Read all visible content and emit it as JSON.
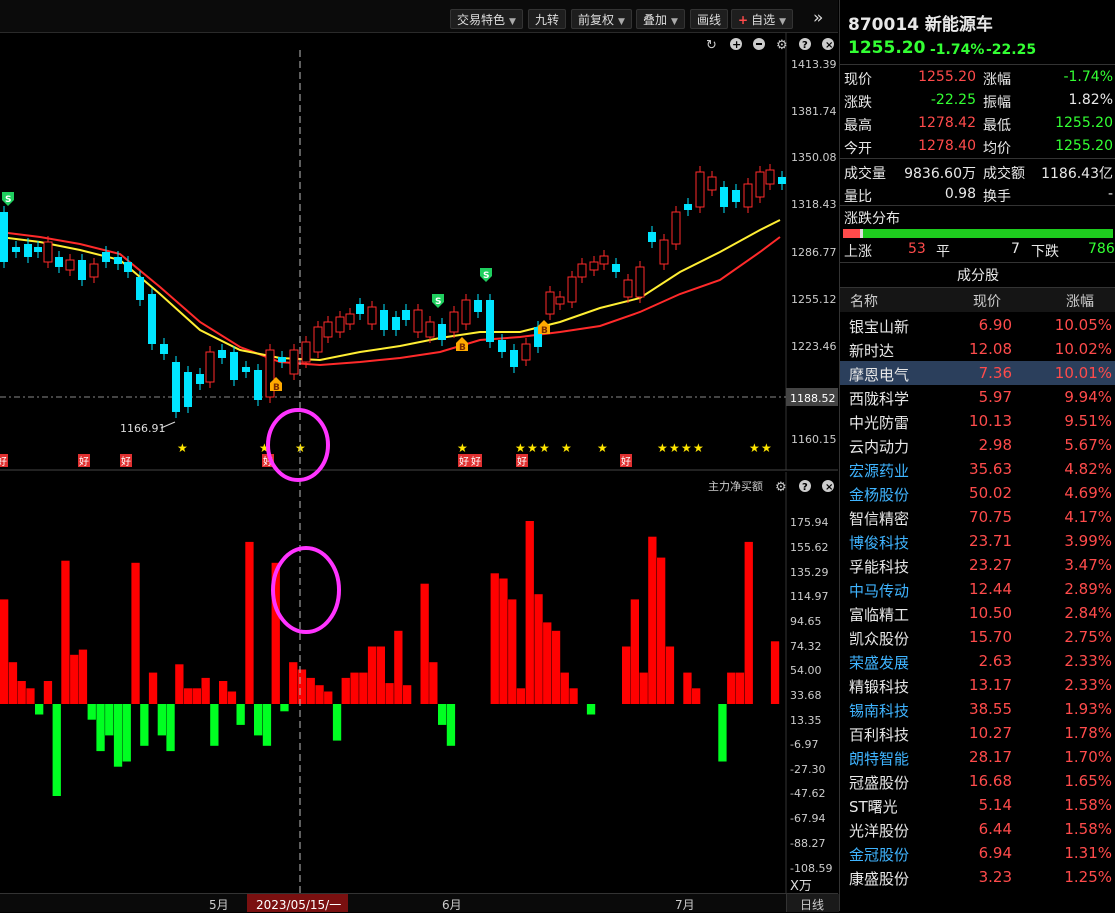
{
  "toolbar": {
    "items": [
      "交易特色",
      "九转",
      "前复权",
      "叠加",
      "画线",
      "自选"
    ],
    "more_icon": "double-chevron-right-icon"
  },
  "main_chart": {
    "y_labels": [
      "1413.39",
      "1381.74",
      "1350.08",
      "1318.43",
      "1286.77",
      "1255.12",
      "1223.46",
      "1160.15"
    ],
    "current_price_tag": "1188.52",
    "low_marker": "1166.91",
    "signal_labels": {
      "hao": "好",
      "b": "B",
      "s": "S"
    },
    "panel_icons": [
      "refresh-icon",
      "zoom-in-icon",
      "zoom-out-icon",
      "settings-icon",
      "help-icon",
      "close-icon"
    ]
  },
  "sub_chart": {
    "title": "主力净买额",
    "y_labels": [
      "175.94",
      "155.62",
      "135.29",
      "114.97",
      "94.65",
      "74.32",
      "54.00",
      "33.68",
      "13.35",
      "-6.97",
      "-27.30",
      "-47.62",
      "-67.94",
      "-88.27",
      "-108.59"
    ],
    "unit": "X万"
  },
  "x_axis": {
    "labels": [
      "5月",
      "6月",
      "7月"
    ],
    "cursor_date": "2023/05/15/一",
    "period": "日线"
  },
  "chart_data": {
    "type": "bar",
    "title": "主力净买额",
    "unit": "万",
    "ylim": [
      -108.59,
      175.94
    ],
    "values": [
      100,
      40,
      22,
      15,
      -10,
      22,
      -88,
      137,
      47,
      52,
      -15,
      -45,
      -30,
      -60,
      -55,
      135,
      -40,
      30,
      -30,
      -45,
      38,
      15,
      15,
      25,
      -40,
      22,
      12,
      -20,
      155,
      -30,
      -40,
      135,
      -7,
      40,
      33,
      25,
      18,
      12,
      -35,
      25,
      30,
      30,
      55,
      55,
      20,
      70,
      18,
      0,
      115,
      40,
      -20,
      -40,
      0,
      0,
      0,
      0,
      125,
      120,
      100,
      15,
      175,
      105,
      78,
      70,
      30,
      15,
      0,
      -10,
      0,
      0,
      0,
      55,
      100,
      30,
      160,
      140,
      55,
      0,
      30,
      15,
      0,
      0,
      -55,
      30,
      30,
      155,
      0,
      0,
      60
    ]
  },
  "stock": {
    "code_name": "870014 新能源车",
    "price": "1255.20",
    "pct": "-1.74%",
    "chg": "-22.25"
  },
  "quotes": [
    {
      "l1": "现价",
      "v1": "1255.20",
      "l2": "涨幅",
      "v2": "-1.74%"
    },
    {
      "l1": "涨跌",
      "v1": "-22.25",
      "l2": "振幅",
      "v2": "1.82%"
    },
    {
      "l1": "最高",
      "v1": "1278.42",
      "l2": "最低",
      "v2": "1255.20"
    },
    {
      "l1": "今开",
      "v1": "1278.40",
      "l2": "均价",
      "v2": "1255.20"
    }
  ],
  "volume": [
    {
      "l1": "成交量",
      "v1": "9836.60万",
      "l2": "成交额",
      "v2": "1186.43亿"
    },
    {
      "l1": "量比",
      "v1": "0.98",
      "l2": "换手",
      "v2": "-"
    }
  ],
  "breadth": {
    "title": "涨跌分布",
    "up_label": "上涨",
    "up": "53",
    "flat_label": "平",
    "flat": "7",
    "down_label": "下跌",
    "down": "786"
  },
  "constituents": {
    "title": "成分股",
    "headers": [
      "名称",
      "现价",
      "涨幅"
    ],
    "rows": [
      {
        "name": "银宝山新",
        "price": "6.90",
        "pct": "10.05%",
        "cyan": false
      },
      {
        "name": "新时达",
        "price": "12.08",
        "pct": "10.02%",
        "cyan": false
      },
      {
        "name": "摩恩电气",
        "price": "7.36",
        "pct": "10.01%",
        "cyan": false
      },
      {
        "name": "西陇科学",
        "price": "5.97",
        "pct": "9.94%",
        "cyan": false
      },
      {
        "name": "中光防雷",
        "price": "10.13",
        "pct": "9.51%",
        "cyan": false
      },
      {
        "name": "云内动力",
        "price": "2.98",
        "pct": "5.67%",
        "cyan": false
      },
      {
        "name": "宏源药业",
        "price": "35.63",
        "pct": "4.82%",
        "cyan": true
      },
      {
        "name": "金杨股份",
        "price": "50.02",
        "pct": "4.69%",
        "cyan": true
      },
      {
        "name": "智信精密",
        "price": "70.75",
        "pct": "4.17%",
        "cyan": false
      },
      {
        "name": "博俊科技",
        "price": "23.71",
        "pct": "3.99%",
        "cyan": true
      },
      {
        "name": "孚能科技",
        "price": "23.27",
        "pct": "3.47%",
        "cyan": false
      },
      {
        "name": "中马传动",
        "price": "12.44",
        "pct": "2.89%",
        "cyan": true
      },
      {
        "name": "富临精工",
        "price": "10.50",
        "pct": "2.84%",
        "cyan": false
      },
      {
        "name": "凯众股份",
        "price": "15.70",
        "pct": "2.75%",
        "cyan": false
      },
      {
        "name": "荣盛发展",
        "price": "2.63",
        "pct": "2.33%",
        "cyan": true
      },
      {
        "name": "精锻科技",
        "price": "13.17",
        "pct": "2.33%",
        "cyan": false
      },
      {
        "name": "锡南科技",
        "price": "38.55",
        "pct": "1.93%",
        "cyan": true
      },
      {
        "name": "百利科技",
        "price": "10.27",
        "pct": "1.78%",
        "cyan": false
      },
      {
        "name": "朗特智能",
        "price": "28.17",
        "pct": "1.70%",
        "cyan": true
      },
      {
        "name": "冠盛股份",
        "price": "16.68",
        "pct": "1.65%",
        "cyan": false
      },
      {
        "name": "ST曙光",
        "price": "5.14",
        "pct": "1.58%",
        "cyan": false
      },
      {
        "name": "光洋股份",
        "price": "6.44",
        "pct": "1.58%",
        "cyan": false
      },
      {
        "name": "金冠股份",
        "price": "6.94",
        "pct": "1.31%",
        "cyan": true
      },
      {
        "name": "康盛股份",
        "price": "3.23",
        "pct": "1.25%",
        "cyan": false
      }
    ]
  }
}
